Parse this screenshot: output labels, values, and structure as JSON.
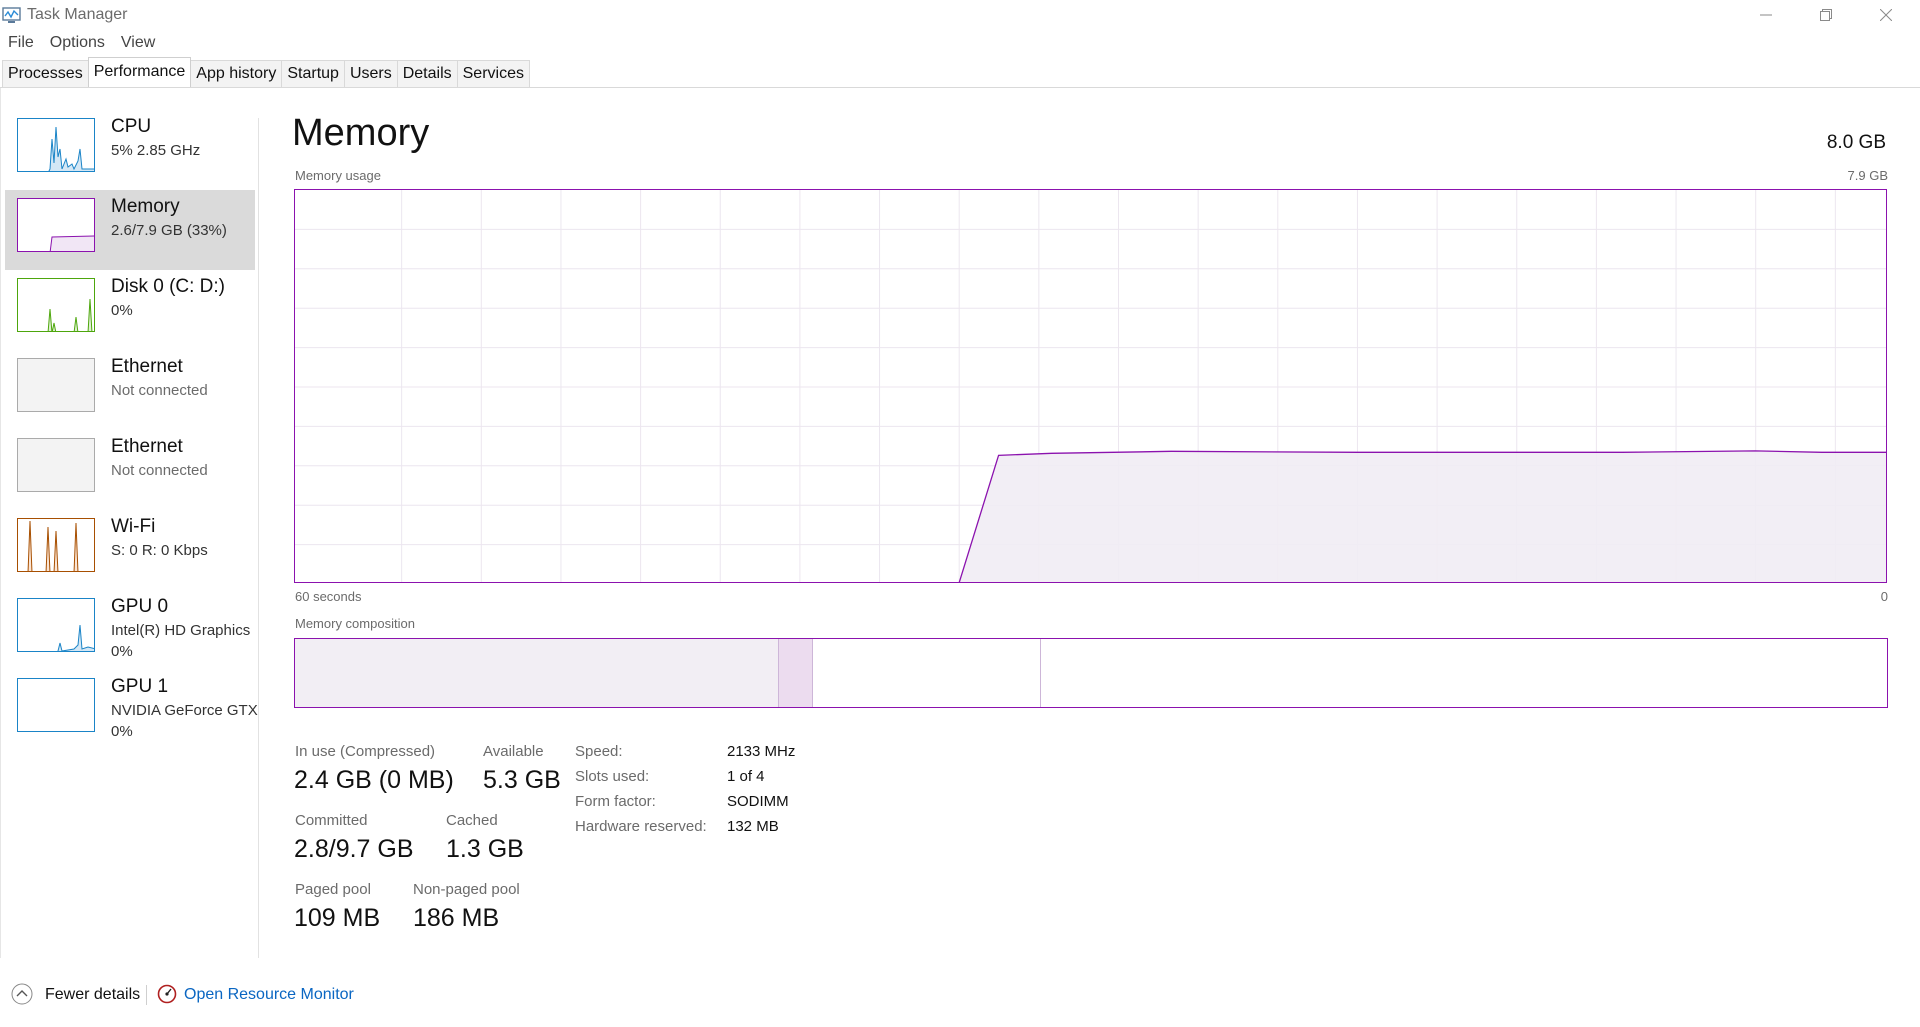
{
  "window": {
    "title": "Task Manager",
    "icon": "task-manager-icon",
    "controls": [
      "minimize-icon",
      "maximize-icon",
      "close-icon"
    ]
  },
  "menu": [
    "File",
    "Options",
    "View"
  ],
  "tabs": [
    {
      "label": "Processes",
      "active": false
    },
    {
      "label": "Performance",
      "active": true
    },
    {
      "label": "App history",
      "active": false
    },
    {
      "label": "Startup",
      "active": false
    },
    {
      "label": "Users",
      "active": false
    },
    {
      "label": "Details",
      "active": false
    },
    {
      "label": "Services",
      "active": false
    }
  ],
  "sidebar": {
    "items": [
      {
        "title": "CPU",
        "sub": "5%  2.85 GHz",
        "sub2": "",
        "color": "#1a84c7",
        "selected": false
      },
      {
        "title": "Memory",
        "sub": "2.6/7.9 GB (33%)",
        "sub2": "",
        "color": "#8b12ae",
        "selected": true
      },
      {
        "title": "Disk 0 (C: D:)",
        "sub": "0%",
        "sub2": "",
        "color": "#4da60c",
        "selected": false
      },
      {
        "title": "Ethernet",
        "sub": "Not connected",
        "sub2": "",
        "color": "#aaaaaa",
        "selected": false
      },
      {
        "title": "Ethernet",
        "sub": "Not connected",
        "sub2": "",
        "color": "#aaaaaa",
        "selected": false
      },
      {
        "title": "Wi-Fi",
        "sub": "S: 0  R: 0 Kbps",
        "sub2": "",
        "color": "#a74f01",
        "selected": false
      },
      {
        "title": "GPU 0",
        "sub": "Intel(R) HD Graphics",
        "sub2": "0%",
        "color": "#1a84c7",
        "selected": false
      },
      {
        "title": "GPU 1",
        "sub": "NVIDIA GeForce GTX",
        "sub2": "0%",
        "color": "#1a84c7",
        "selected": false
      }
    ]
  },
  "main": {
    "title": "Memory",
    "total": "8.0 GB",
    "usage_label": "Memory usage",
    "usage_max": "7.9 GB",
    "x_left": "60 seconds",
    "x_right": "0",
    "composition_label": "Memory composition",
    "accent_color": "#8b12ae",
    "usage_fraction": 0.33
  },
  "chart_data": {
    "type": "area",
    "title": "Memory usage",
    "xlabel": "",
    "ylabel": "",
    "x_range_seconds": [
      60,
      0
    ],
    "ylim": [
      0,
      7.9
    ],
    "y_unit": "GB",
    "grid": true,
    "series": [
      {
        "x": [
          60,
          35,
          33.5,
          31.5,
          27,
          20,
          10,
          5,
          2.5,
          0
        ],
        "values": [
          0,
          0,
          2.58,
          2.62,
          2.66,
          2.64,
          2.64,
          2.67,
          2.64,
          2.64
        ]
      }
    ]
  },
  "composition": {
    "total_gb": 7.9,
    "segments": [
      {
        "name": "in-use",
        "gb": 2.4,
        "fill": "#f2eef4",
        "border": "#cdb6d8"
      },
      {
        "name": "modified",
        "gb": 0.17,
        "fill": "#ecdcef",
        "border": "#cdb6d8"
      },
      {
        "name": "standby",
        "gb": 1.13,
        "fill": "#ffffff",
        "border": "#cdb6d8"
      },
      {
        "name": "free",
        "gb": 4.2,
        "fill": "#ffffff",
        "border": "none"
      }
    ]
  },
  "stats": {
    "in_use_label": "In use (Compressed)",
    "in_use_value": "2.4 GB (0 MB)",
    "available_label": "Available",
    "available_value": "5.3 GB",
    "committed_label": "Committed",
    "committed_value": "2.8/9.7 GB",
    "cached_label": "Cached",
    "cached_value": "1.3 GB",
    "paged_label": "Paged pool",
    "paged_value": "109 MB",
    "nonpaged_label": "Non-paged pool",
    "nonpaged_value": "186 MB",
    "speed_label": "Speed:",
    "speed_value": "2133 MHz",
    "slots_label": "Slots used:",
    "slots_value": "1 of 4",
    "form_label": "Form factor:",
    "form_value": "SODIMM",
    "hw_label": "Hardware reserved:",
    "hw_value": "132 MB"
  },
  "footer": {
    "fewer": "Fewer details",
    "monitor": "Open Resource Monitor"
  }
}
